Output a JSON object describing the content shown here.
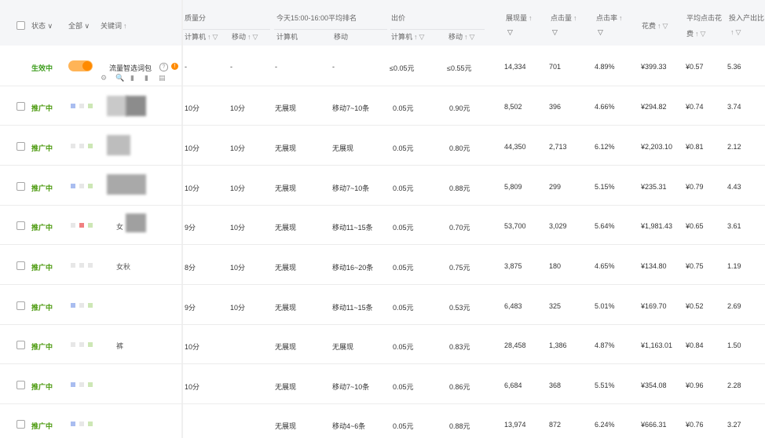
{
  "header": {
    "status_filter": "状态",
    "all_filter": "全部",
    "keyword": "关键词",
    "quality_score": "质量分",
    "qs_pc": "计算机",
    "qs_mobile": "移动",
    "rank_group": "今天15:00-16:00平均排名",
    "rank_pc": "计算机",
    "rank_mobile": "移动",
    "bid_group": "出价",
    "bid_pc": "计算机",
    "bid_mobile": "移动",
    "impressions": "展现量",
    "clicks": "点击量",
    "ctr": "点击率",
    "spend": "花费",
    "avg_cpc_1": "平均点击花",
    "avg_cpc_2": "费",
    "roi": "投入产出比",
    "sort_arrow": "↑",
    "filter_icon": "▽",
    "chevron": "∨"
  },
  "smart_row": {
    "status": "生效中",
    "keyword": "流量智选词包",
    "qs_pc": "-",
    "qs_mobile": "-",
    "rank_pc": "-",
    "rank_mobile": "-",
    "bid_pc": "≤0.05元",
    "bid_mobile": "≤0.55元",
    "impressions": "14,334",
    "clicks": "701",
    "ctr": "4.89%",
    "spend": "¥399.33",
    "avg_cpc": "¥0.57",
    "roi": "5.36",
    "help": "?",
    "warn": "!",
    "tools": [
      "⚙",
      "🔍",
      "▮",
      "▮",
      "▤"
    ]
  },
  "rows": [
    {
      "status": "推广中",
      "keyword": "",
      "qs_pc": "10分",
      "qs_mobile": "10分",
      "rank_pc": "无展现",
      "rank_mobile": "移动7~10条",
      "bid_pc": "0.05元",
      "bid_mobile": "0.90元",
      "impressions": "8,502",
      "clicks": "396",
      "ctr": "4.66%",
      "spend": "¥294.82",
      "avg_cpc": "¥0.74",
      "roi": "3.74"
    },
    {
      "status": "推广中",
      "keyword": "",
      "qs_pc": "10分",
      "qs_mobile": "10分",
      "rank_pc": "无展现",
      "rank_mobile": "无展现",
      "bid_pc": "0.05元",
      "bid_mobile": "0.80元",
      "impressions": "44,350",
      "clicks": "2,713",
      "ctr": "6.12%",
      "spend": "¥2,203.10",
      "avg_cpc": "¥0.81",
      "roi": "2.12"
    },
    {
      "status": "推广中",
      "keyword": "",
      "qs_pc": "10分",
      "qs_mobile": "10分",
      "rank_pc": "无展现",
      "rank_mobile": "移动7~10条",
      "bid_pc": "0.05元",
      "bid_mobile": "0.88元",
      "impressions": "5,809",
      "clicks": "299",
      "ctr": "5.15%",
      "spend": "¥235.31",
      "avg_cpc": "¥0.79",
      "roi": "4.43"
    },
    {
      "status": "推广中",
      "keyword": "女",
      "qs_pc": "9分",
      "qs_mobile": "10分",
      "rank_pc": "无展现",
      "rank_mobile": "移动11~15条",
      "bid_pc": "0.05元",
      "bid_mobile": "0.70元",
      "impressions": "53,700",
      "clicks": "3,029",
      "ctr": "5.64%",
      "spend": "¥1,981.43",
      "avg_cpc": "¥0.65",
      "roi": "3.61"
    },
    {
      "status": "推广中",
      "keyword": "女秋",
      "qs_pc": "8分",
      "qs_mobile": "10分",
      "rank_pc": "无展现",
      "rank_mobile": "移动16~20条",
      "bid_pc": "0.05元",
      "bid_mobile": "0.75元",
      "impressions": "3,875",
      "clicks": "180",
      "ctr": "4.65%",
      "spend": "¥134.80",
      "avg_cpc": "¥0.75",
      "roi": "1.19"
    },
    {
      "status": "推广中",
      "keyword": "",
      "qs_pc": "9分",
      "qs_mobile": "10分",
      "rank_pc": "无展现",
      "rank_mobile": "移动11~15条",
      "bid_pc": "0.05元",
      "bid_mobile": "0.53元",
      "impressions": "6,483",
      "clicks": "325",
      "ctr": "5.01%",
      "spend": "¥169.70",
      "avg_cpc": "¥0.52",
      "roi": "2.69"
    },
    {
      "status": "推广中",
      "keyword": "裤",
      "qs_pc": "10分",
      "qs_mobile": "",
      "rank_pc": "无展现",
      "rank_mobile": "无展现",
      "bid_pc": "0.05元",
      "bid_mobile": "0.83元",
      "impressions": "28,458",
      "clicks": "1,386",
      "ctr": "4.87%",
      "spend": "¥1,163.01",
      "avg_cpc": "¥0.84",
      "roi": "1.50"
    },
    {
      "status": "推广中",
      "keyword": "",
      "qs_pc": "10分",
      "qs_mobile": "",
      "rank_pc": "无展现",
      "rank_mobile": "移动7~10条",
      "bid_pc": "0.05元",
      "bid_mobile": "0.86元",
      "impressions": "6,684",
      "clicks": "368",
      "ctr": "5.51%",
      "spend": "¥354.08",
      "avg_cpc": "¥0.96",
      "roi": "2.28"
    },
    {
      "status": "推广中",
      "keyword": "",
      "qs_pc": "",
      "qs_mobile": "",
      "rank_pc": "无展现",
      "rank_mobile": "移动4~6条",
      "bid_pc": "0.05元",
      "bid_mobile": "0.88元",
      "impressions": "13,974",
      "clicks": "872",
      "ctr": "6.24%",
      "spend": "¥666.31",
      "avg_cpc": "¥0.76",
      "roi": "3.27"
    }
  ],
  "colors": {
    "accent": "#ff8a00",
    "status_green": "#4c9a0f"
  }
}
